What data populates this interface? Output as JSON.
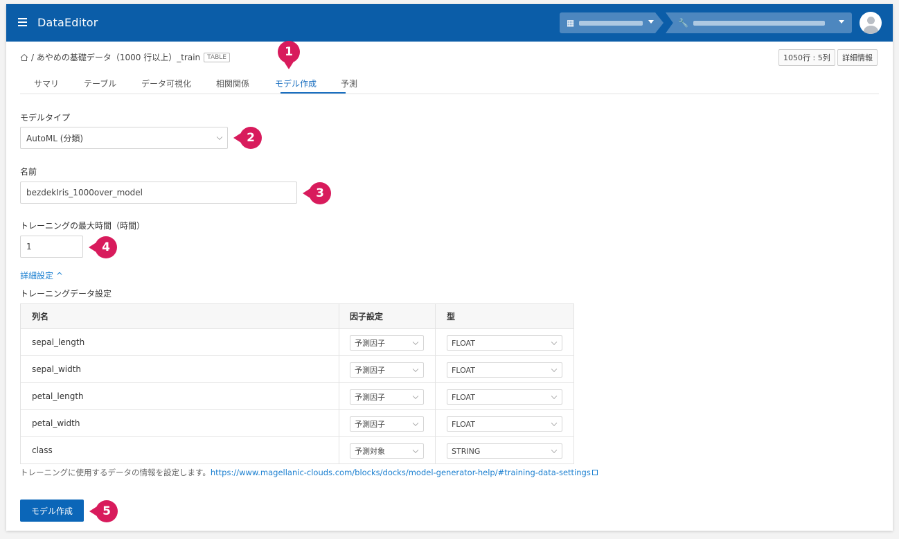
{
  "header": {
    "app_title": "DataEditor",
    "accent_color": "#0b5da8"
  },
  "breadcrumb": {
    "path": "/ あやめの基礎データ（1000 行以上）_train",
    "badge": "TABLE"
  },
  "stats": {
    "rows_cols": "1050行 : 5列",
    "detail_button": "詳細情報"
  },
  "tabs": [
    {
      "label": "サマリ"
    },
    {
      "label": "テーブル"
    },
    {
      "label": "データ可視化"
    },
    {
      "label": "相関関係"
    },
    {
      "label": "モデル作成"
    },
    {
      "label": "予測"
    }
  ],
  "form": {
    "model_type_label": "モデルタイプ",
    "model_type_value": "AutoML (分類)",
    "name_label": "名前",
    "name_value": "bezdekIris_1000over_model",
    "max_time_label": "トレーニングの最大時間（時間）",
    "max_time_value": "1",
    "advanced_link": "詳細設定 ^",
    "training_settings_label": "トレーニングデータ設定"
  },
  "table": {
    "headers": [
      "列名",
      "因子設定",
      "型"
    ],
    "rows": [
      {
        "name": "sepal_length",
        "factor": "予測因子",
        "type": "FLOAT"
      },
      {
        "name": "sepal_width",
        "factor": "予測因子",
        "type": "FLOAT"
      },
      {
        "name": "petal_length",
        "factor": "予測因子",
        "type": "FLOAT"
      },
      {
        "name": "petal_width",
        "factor": "予測因子",
        "type": "FLOAT"
      },
      {
        "name": "class",
        "factor": "予測対象",
        "type": "STRING"
      }
    ]
  },
  "help": {
    "text": "トレーニングに使用するデータの情報を設定します。",
    "link": "https://www.magellanic-clouds.com/blocks/docks/model-generator-help/#training-data-settings"
  },
  "actions": {
    "create_button": "モデル作成"
  },
  "markers": [
    "1",
    "2",
    "3",
    "4",
    "5"
  ]
}
